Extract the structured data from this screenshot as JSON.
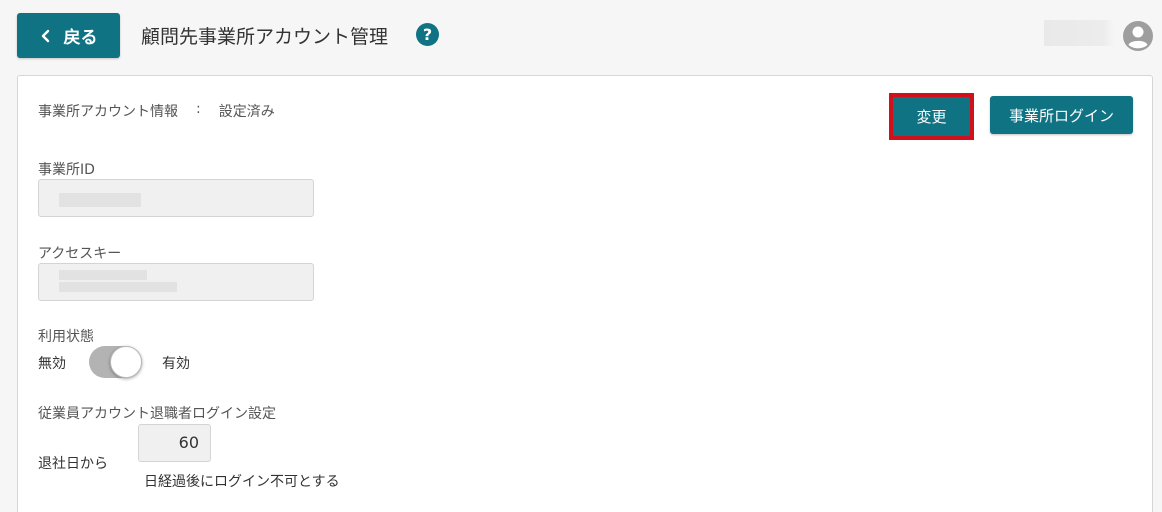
{
  "header": {
    "back_label": "戻る",
    "title": "顧問先事業所アカウント管理",
    "help_glyph": "?"
  },
  "account_info": {
    "label": "事業所アカウント情報",
    "separator": ":",
    "status": "設定済み"
  },
  "actions": {
    "change_label": "変更",
    "login_label": "事業所ログイン"
  },
  "fields": {
    "office_id_label": "事業所ID",
    "access_key_label": "アクセスキー"
  },
  "usage": {
    "label": "利用状態",
    "off_label": "無効",
    "on_label": "有効",
    "enabled": true
  },
  "retirement": {
    "label": "従業員アカウント退職者ログイン設定",
    "prefix": "退社日から",
    "days": "60",
    "suffix": "日経過後にログイン不可とする"
  },
  "colors": {
    "accent": "#0f7384",
    "highlight": "#d0101a"
  }
}
